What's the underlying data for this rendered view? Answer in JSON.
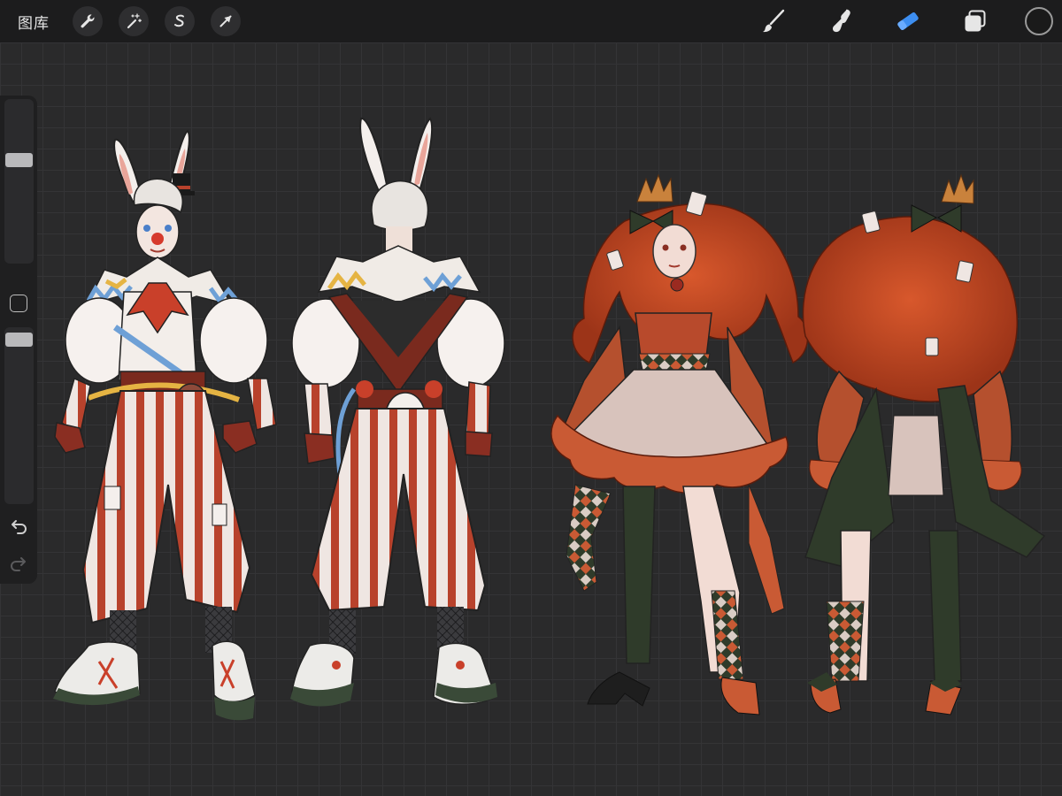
{
  "toolbar": {
    "gallery_label": "图库",
    "adjust_tools": [
      {
        "name": "actions",
        "icon": "wrench-icon"
      },
      {
        "name": "adjustments",
        "icon": "magic-wand-icon"
      },
      {
        "name": "selection",
        "icon": "selection-s-icon"
      },
      {
        "name": "transform",
        "icon": "arrow-cursor-icon"
      }
    ],
    "right_tools": [
      {
        "name": "brush",
        "icon": "brush-icon",
        "active": false
      },
      {
        "name": "smudge",
        "icon": "smudge-finger-icon",
        "active": false
      },
      {
        "name": "eraser",
        "icon": "eraser-icon",
        "active": true
      },
      {
        "name": "layers",
        "icon": "layers-icon",
        "active": false
      }
    ],
    "current_color": "#1a1a1a",
    "active_color": "#3d8ef0"
  },
  "sidebar": {
    "brush_size_level": 0.64,
    "opacity_level": 0.97,
    "modify_button_icon": "square-icon",
    "undo_icon": "undo-arrow-icon",
    "redo_icon": "redo-arrow-icon",
    "redo_enabled": false
  },
  "canvas": {
    "figures": [
      {
        "name": "rabbit-clown-front-view"
      },
      {
        "name": "rabbit-clown-back-view"
      },
      {
        "name": "queen-of-hearts-front-view"
      },
      {
        "name": "queen-of-hearts-back-view"
      }
    ]
  }
}
